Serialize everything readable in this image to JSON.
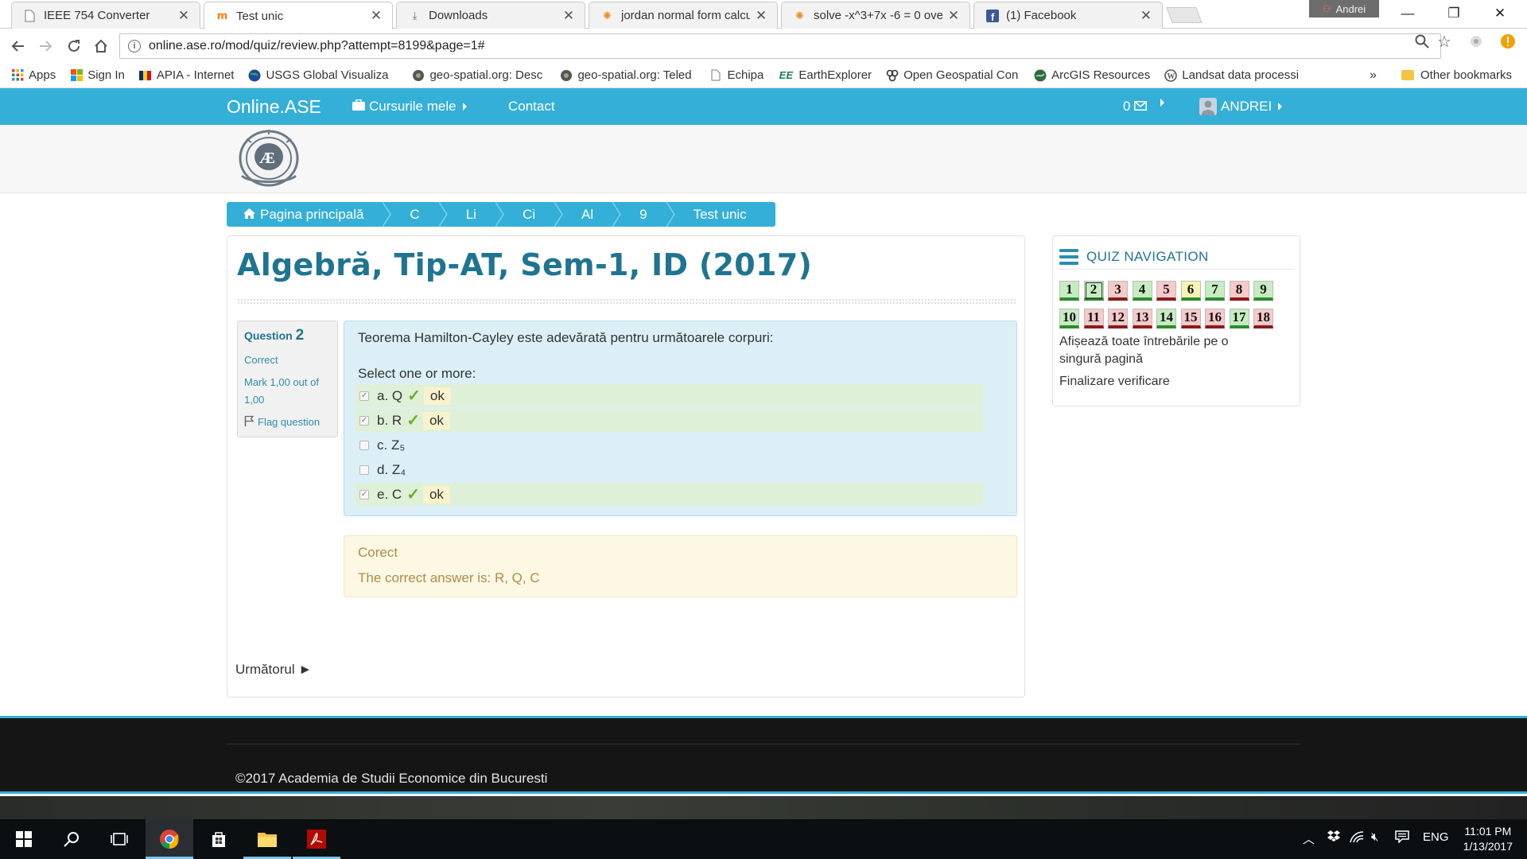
{
  "browser": {
    "tabs": [
      {
        "title": "IEEE 754 Converter",
        "icon": "page-icon",
        "active": false
      },
      {
        "title": "Test unic",
        "icon": "moodle-icon",
        "active": true
      },
      {
        "title": "Downloads",
        "icon": "download-icon",
        "active": false
      },
      {
        "title": "jordan normal form calcu",
        "icon": "wolfram-icon",
        "active": false
      },
      {
        "title": "solve -x^3+7x -6 = 0 ove",
        "icon": "wolfram-icon",
        "active": false
      },
      {
        "title": "(1) Facebook",
        "icon": "facebook-icon",
        "active": false
      }
    ],
    "profile_name": "Andrei",
    "url": "online.ase.ro/mod/quiz/review.php?attempt=8199&page=1#",
    "bookmarks": [
      {
        "label": "Apps",
        "icon": "apps-grid-icon"
      },
      {
        "label": "Sign In",
        "icon": "microsoft-icon"
      },
      {
        "label": "APIA - Internet",
        "icon": "flag-icon"
      },
      {
        "label": "USGS Global Visualiza",
        "icon": "globe-icon"
      },
      {
        "label": "geo-spatial.org: Desc",
        "icon": "geo-icon"
      },
      {
        "label": "geo-spatial.org: Teled",
        "icon": "geo-icon"
      },
      {
        "label": "Echipa",
        "icon": "page-icon"
      },
      {
        "label": "EarthExplorer",
        "icon": "ee-icon"
      },
      {
        "label": "Open Geospatial Con",
        "icon": "ogc-icon"
      },
      {
        "label": "ArcGIS Resources",
        "icon": "arcgis-icon"
      },
      {
        "label": "Landsat data processi",
        "icon": "wordpress-icon"
      }
    ],
    "bookmarks_more": "»",
    "other_bookmarks": "Other bookmarks"
  },
  "site": {
    "brand": "Online.ASE",
    "nav_courses": "Cursurile mele",
    "nav_contact": "Contact",
    "messages_count": "0",
    "user_name": "ANDREI"
  },
  "breadcrumb": [
    "Pagina principală",
    "C",
    "Li",
    "Ci",
    "Al",
    "9",
    "Test unic"
  ],
  "page": {
    "title": "Algebră, Tip-AT, Sem-1, ID (2017)"
  },
  "question": {
    "label": "Question",
    "number": "2",
    "state": "Correct",
    "grade": "Mark 1,00 out of 1,00",
    "flag": "Flag question",
    "text": "Teorema Hamilton-Cayley este adevărată pentru următoarele corpuri:",
    "prompt": "Select one or more:",
    "answers": [
      {
        "text": "a. Q",
        "checked": true,
        "correct": true,
        "mark": "ok"
      },
      {
        "text": "b. R",
        "checked": true,
        "correct": true,
        "mark": "ok"
      },
      {
        "text": "c. Z₅",
        "checked": false,
        "correct": false,
        "mark": ""
      },
      {
        "text": "d. Z₄",
        "checked": false,
        "correct": false,
        "mark": ""
      },
      {
        "text": "e. C",
        "checked": true,
        "correct": true,
        "mark": "ok"
      }
    ],
    "feedback_state": "Corect",
    "feedback_answer": "The correct answer is: R, Q, C"
  },
  "next_label": "Următorul ►",
  "quiz_nav": {
    "title": "QUIZ NAVIGATION",
    "buttons": [
      {
        "n": "1",
        "state": "ok"
      },
      {
        "n": "2",
        "state": "ok"
      },
      {
        "n": "3",
        "state": "bad"
      },
      {
        "n": "4",
        "state": "ok"
      },
      {
        "n": "5",
        "state": "bad"
      },
      {
        "n": "6",
        "state": "partial"
      },
      {
        "n": "7",
        "state": "ok"
      },
      {
        "n": "8",
        "state": "bad"
      },
      {
        "n": "9",
        "state": "ok"
      },
      {
        "n": "10",
        "state": "ok"
      },
      {
        "n": "11",
        "state": "bad"
      },
      {
        "n": "12",
        "state": "bad"
      },
      {
        "n": "13",
        "state": "bad"
      },
      {
        "n": "14",
        "state": "ok"
      },
      {
        "n": "15",
        "state": "bad"
      },
      {
        "n": "16",
        "state": "bad"
      },
      {
        "n": "17",
        "state": "ok"
      },
      {
        "n": "18",
        "state": "bad"
      }
    ],
    "current": "2",
    "show_all": "Afișează toate întrebările pe o singură pagină",
    "finish": "Finalizare verificare"
  },
  "footer": {
    "copyright": "©2017 Academia de Studii Economice din Bucuresti"
  },
  "taskbar": {
    "language": "ENG",
    "time": "11:01 PM",
    "date": "1/13/2017"
  },
  "colors": {
    "accent": "#34afd7",
    "title": "#1f7491",
    "correct_bg": "#dff0d8",
    "feedback_bg": "#fcf8e3"
  }
}
